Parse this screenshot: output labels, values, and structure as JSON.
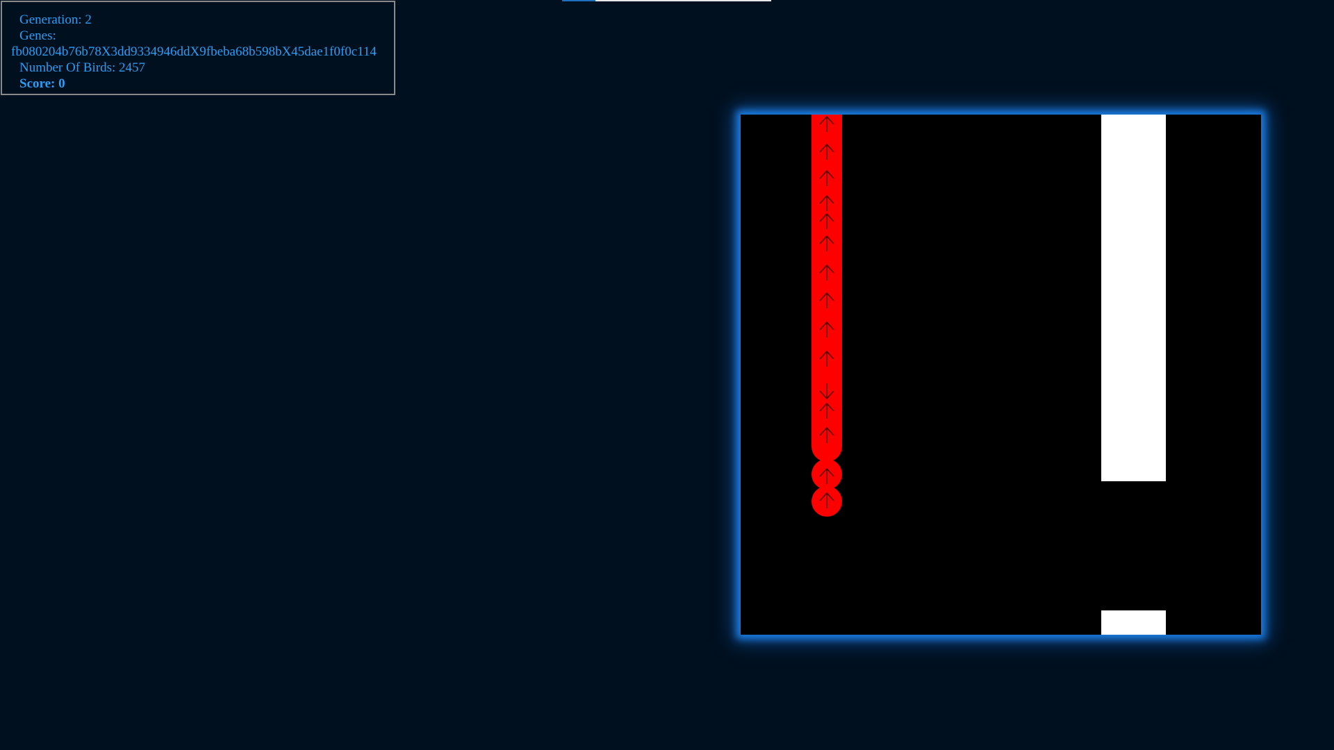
{
  "stats": {
    "generation": "Generation: 2",
    "genes_label": "Genes:",
    "genes_value": "fb080204b76b78X3dd9334946ddX9fbeba68b598bX45dae1f0f0c114",
    "birds": "Number Of Birds: 2457",
    "score": "Score: 0"
  },
  "progress": {
    "fraction": 0.16
  },
  "colors": {
    "background": "#00101f",
    "text": "#2a9df4",
    "bird": "#ff0000",
    "pipe": "#ffffff",
    "canvas": "#000000",
    "glow": "#1a7be0"
  },
  "birds": {
    "trail_arrows": [
      "up",
      "up",
      "up",
      "up",
      "up",
      "up",
      "up",
      "up",
      "up",
      "up",
      "down",
      "up",
      "up"
    ],
    "bird_arrows": [
      "up",
      "up"
    ]
  }
}
